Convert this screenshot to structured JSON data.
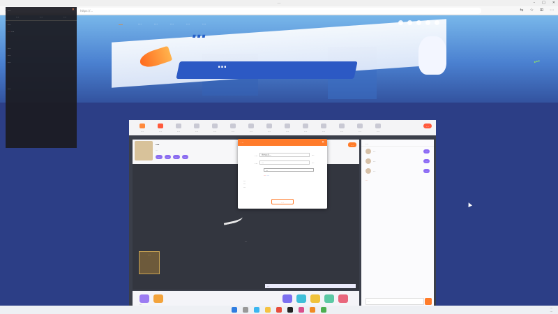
{
  "window": {
    "title": "…",
    "url": "https://…"
  },
  "site": {
    "logo": "…",
    "nav": [
      "…",
      "…",
      "…",
      "…",
      "…"
    ]
  },
  "banner": {
    "headline": "…",
    "date_text": "…"
  },
  "overlay": {
    "title": "…",
    "tabs": [
      "…",
      "…",
      "…"
    ],
    "messages": [
      "…",
      "…",
      "…",
      "…",
      "…",
      "…"
    ],
    "highlight": "…"
  },
  "categories": [
    "…",
    "…",
    "…",
    "…",
    "…",
    "…",
    "…",
    "…",
    "…",
    "…",
    "…",
    "…",
    "…",
    "…",
    "…"
  ],
  "room": {
    "title": "…",
    "subtitle": "…",
    "tags": [
      "…",
      "…",
      "…",
      "…"
    ],
    "subscribe": "…",
    "video_text": "…",
    "gift_label": "…",
    "barrage_placeholder": "…",
    "gift_input": "…"
  },
  "chat": {
    "header": "…",
    "fans": [
      {
        "name": "…",
        "badge": "…"
      },
      {
        "name": "…",
        "badge": "…"
      },
      {
        "name": "…",
        "badge": "…"
      }
    ],
    "notice": "…",
    "input_placeholder": "…"
  },
  "modal": {
    "title": "…",
    "server_label": "…",
    "server_value": "rtmp://…",
    "server_action": "…",
    "key_label": "…",
    "key_value": "…",
    "key_action": "…",
    "select_value": "…",
    "warning": "…",
    "warning_link": "…",
    "tips": [
      "…",
      "…",
      "…"
    ],
    "confirm": "…"
  },
  "clock": {
    "time": "…",
    "date": "…"
  }
}
